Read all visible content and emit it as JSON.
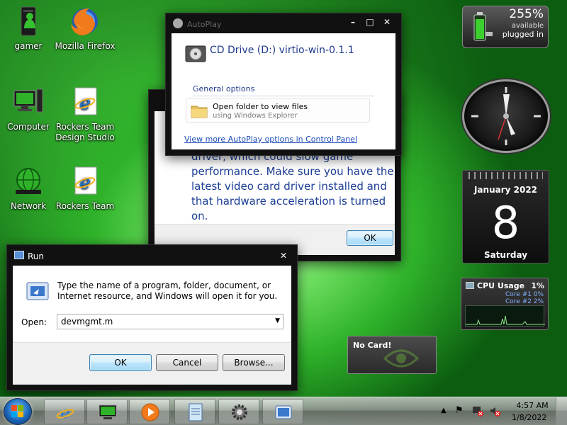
{
  "desktop_icons": {
    "gamer": "gamer",
    "firefox": "Mozilla Firefox",
    "computer": "Computer",
    "rockers_studio": "Rockers Team\nDesign Studio",
    "network": "Network",
    "rockers_team": "Rockers Team"
  },
  "game_dialog": {
    "message": "driver, which could slow game performance. Make sure you have the latest video card driver installed and that hardware acceleration is turned on.",
    "ok_label": "OK"
  },
  "autoplay": {
    "title": "AutoPlay",
    "drive_title": "CD Drive (D:) virtio-win-0.1.1",
    "section_label": "General options",
    "option_main": "Open folder to view files",
    "option_sub": "using Windows Explorer",
    "link": "View more AutoPlay options in Control Panel"
  },
  "run_dialog": {
    "title": "Run",
    "description": "Type the name of a program, folder, document, or Internet resource, and Windows will open it for you.",
    "open_label": "Open:",
    "open_value": "devmgmt.m",
    "ok_label": "OK",
    "cancel_label": "Cancel",
    "browse_label": "Browse..."
  },
  "battery_gadget": {
    "percent": "255%",
    "available": "available",
    "status": "plugged in"
  },
  "calendar_gadget": {
    "month": "January 2022",
    "day": "8",
    "weekday": "Saturday"
  },
  "cpu_gadget": {
    "title": "CPU Usage",
    "total": "1%",
    "core1_label": "Core #1",
    "core1_value": "0%",
    "core2_label": "Core #2",
    "core2_value": "2%"
  },
  "nocard_gadget": {
    "label": "No Card!"
  },
  "taskbar": {
    "time": "4:57 AM",
    "date": "1/8/2022"
  },
  "colors": {
    "desktop_green": "#2fb22a",
    "dialog_text_blue": "#1b3d95",
    "link_blue": "#1c4bb8"
  }
}
